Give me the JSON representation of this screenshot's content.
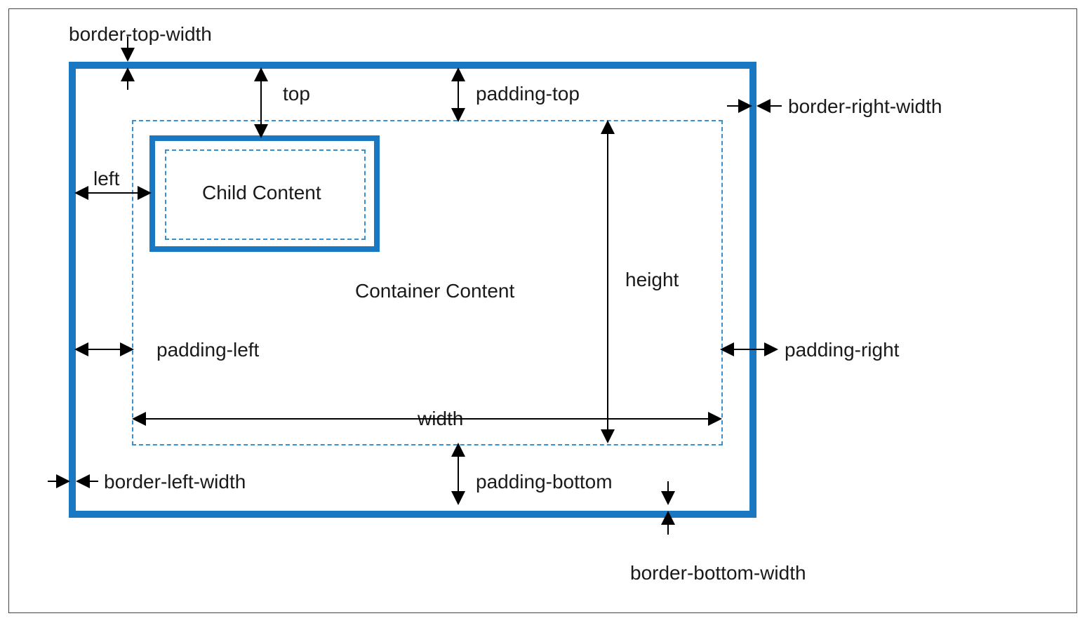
{
  "labels": {
    "border_top_width": "border-top-width",
    "border_right_width": "border-right-width",
    "border_bottom_width": "border-bottom-width",
    "border_left_width": "border-left-width",
    "padding_top": "padding-top",
    "padding_right": "padding-right",
    "padding_bottom": "padding-bottom",
    "padding_left": "padding-left",
    "top": "top",
    "left": "left",
    "width": "width",
    "height": "height",
    "container_content": "Container Content",
    "child_content": "Child Content"
  },
  "colors": {
    "border": "#1a78c2",
    "dashed": "#3a8fcf",
    "text": "#1a1a1a"
  }
}
